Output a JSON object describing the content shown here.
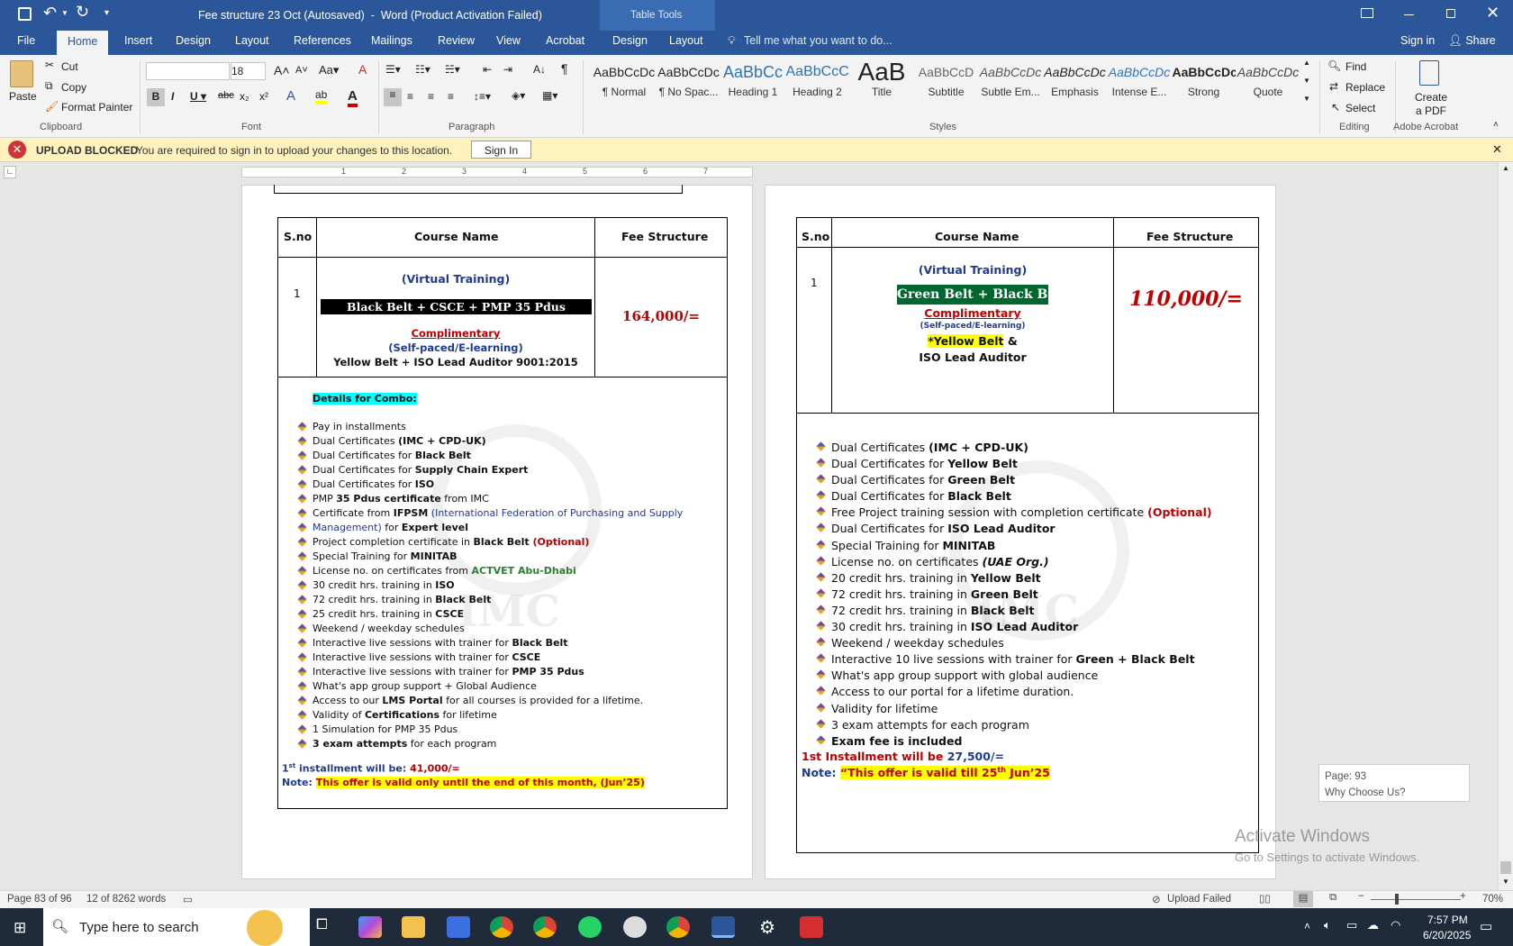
{
  "titlebar": {
    "title": "Fee structure 23 Oct (Autosaved)  -  Word (Product Activation Failed)",
    "table_tools": "Table Tools"
  },
  "tabs": {
    "file": "File",
    "home": "Home",
    "insert": "Insert",
    "design": "Design",
    "layout": "Layout",
    "references": "References",
    "mailings": "Mailings",
    "review": "Review",
    "view": "View",
    "acrobat": "Acrobat",
    "tt_design": "Design",
    "tt_layout": "Layout",
    "tell_me": "Tell me what you want to do...",
    "sign_in": "Sign in",
    "share": "Share"
  },
  "clipboard": {
    "paste": "Paste",
    "cut": "Cut",
    "copy": "Copy",
    "format_painter": "Format Painter",
    "label": "Clipboard"
  },
  "font": {
    "name": "",
    "size": "18",
    "label": "Font"
  },
  "paragraph": {
    "label": "Paragraph"
  },
  "styles": {
    "label": "Styles",
    "items": [
      {
        "preview": "AaBbCcDc",
        "name": "¶ Normal"
      },
      {
        "preview": "AaBbCcDc",
        "name": "¶ No Spac..."
      },
      {
        "preview": "AaBbCc",
        "name": "Heading 1"
      },
      {
        "preview": "AaBbCcC",
        "name": "Heading 2"
      },
      {
        "preview": "AaB",
        "name": "Title"
      },
      {
        "preview": "AaBbCcD",
        "name": "Subtitle"
      },
      {
        "preview": "AaBbCcDc",
        "name": "Subtle Em..."
      },
      {
        "preview": "AaBbCcDc",
        "name": "Emphasis"
      },
      {
        "preview": "AaBbCcDc",
        "name": "Intense E..."
      },
      {
        "preview": "AaBbCcDc",
        "name": "Strong"
      },
      {
        "preview": "AaBbCcDc",
        "name": "Quote"
      }
    ]
  },
  "editing": {
    "find": "Find",
    "replace": "Replace",
    "select": "Select",
    "label": "Editing"
  },
  "acrobat_group": {
    "create": "Create",
    "pdf": "a PDF",
    "label": "Adobe Acrobat"
  },
  "infobar": {
    "title": "UPLOAD BLOCKED",
    "message": "You are required to sign in to upload your changes to this location.",
    "button": "Sign In"
  },
  "left_page": {
    "headers": [
      "S.no",
      "Course Name",
      "Fee Structure"
    ],
    "sno": "1",
    "virtual": "(Virtual Training)",
    "course": "Black Belt + CSCE + PMP 35 Pdus",
    "complimentary": "Complimentary",
    "selfpaced": "(Self-paced/E-learning)",
    "extra": "Yellow Belt + ISO Lead Auditor 9001:2015",
    "fee": "164,000/=",
    "details": "Details for Combo:",
    "bullets": [
      [
        [
          "Pay in installments",
          ""
        ]
      ],
      [
        [
          "Dual Certificates ",
          ""
        ],
        [
          "(IMC + CPD-UK)",
          "b"
        ]
      ],
      [
        [
          "Dual Certificates for ",
          ""
        ],
        [
          "Black Belt",
          "b"
        ]
      ],
      [
        [
          "Dual Certificates for ",
          ""
        ],
        [
          "Supply Chain Expert",
          "b"
        ]
      ],
      [
        [
          "Dual Certificates for ",
          ""
        ],
        [
          "ISO",
          "b"
        ]
      ],
      [
        [
          "PMP ",
          ""
        ],
        [
          "35 Pdus certificate",
          "b"
        ],
        [
          " from IMC",
          ""
        ]
      ],
      [
        [
          "Certificate from ",
          ""
        ],
        [
          "IFPSM",
          "b"
        ],
        [
          " (International Federation of Purchasing and Supply",
          "nav"
        ]
      ],
      [
        [
          "Management)",
          "nav"
        ],
        [
          " for ",
          ""
        ],
        [
          "Expert level",
          "b"
        ]
      ],
      [
        [
          "Project completion certificate in ",
          ""
        ],
        [
          "Black Belt",
          "b"
        ],
        [
          " (Optional)",
          "red"
        ]
      ],
      [
        [
          "Special Training for ",
          ""
        ],
        [
          "MINITAB",
          "b"
        ]
      ],
      [
        [
          "License no. on certificates from ",
          ""
        ],
        [
          "ACTVET Abu-Dhabi",
          "grn"
        ]
      ],
      [
        [
          "30 credit hrs. training in ",
          ""
        ],
        [
          "ISO",
          "b"
        ]
      ],
      [
        [
          "72 credit hrs. training in ",
          ""
        ],
        [
          "Black Belt",
          "b"
        ]
      ],
      [
        [
          "25 credit hrs. training in ",
          ""
        ],
        [
          "CSCE",
          "b"
        ]
      ],
      [
        [
          "Weekend / weekday schedules",
          ""
        ]
      ],
      [
        [
          "Interactive live sessions with trainer for ",
          ""
        ],
        [
          "Black Belt",
          "b"
        ]
      ],
      [
        [
          "Interactive live sessions with trainer for ",
          ""
        ],
        [
          "CSCE",
          "b"
        ]
      ],
      [
        [
          "Interactive live sessions with trainer for ",
          ""
        ],
        [
          "PMP 35 Pdus",
          "b"
        ]
      ],
      [
        [
          "What's app group support + Global Audience",
          ""
        ]
      ],
      [
        [
          " Access to our ",
          ""
        ],
        [
          "LMS Portal",
          "b"
        ],
        [
          " for all courses is provided for a lifetime.",
          ""
        ]
      ],
      [
        [
          "Validity of ",
          ""
        ],
        [
          "Certifications",
          "b"
        ],
        [
          " for lifetime",
          ""
        ]
      ],
      [
        [
          "1 Simulation for PMP 35 Pdus",
          ""
        ]
      ],
      [
        [
          "3 exam attempts",
          "b"
        ],
        [
          " for each program",
          ""
        ]
      ]
    ],
    "installment_prefix": "1",
    "installment_sup": "st",
    "installment_label": " installment will be: ",
    "installment_amount": "41,000/=",
    "note_label": "Note: ",
    "note_text": "This offer is valid only until the end of this month, (Jun’25)"
  },
  "right_page": {
    "headers": [
      "S.no",
      "Course Name",
      "Fee Structure"
    ],
    "sno": "1",
    "virtual": "(Virtual Training)",
    "course": "Green Belt + Black Belt",
    "complimentary": "Complimentary",
    "selfpaced": "(Self-paced/E-learning)",
    "extra1": "*Yellow Belt",
    "extra1b": " &",
    "extra2": "ISO Lead Auditor",
    "fee": "110,000/=",
    "bullets": [
      [
        [
          "Dual Certificates ",
          ""
        ],
        [
          "(IMC + CPD-UK)",
          "b"
        ]
      ],
      [
        [
          "Dual Certificates for ",
          ""
        ],
        [
          "Yellow Belt",
          "b"
        ]
      ],
      [
        [
          "Dual Certificates for ",
          ""
        ],
        [
          "Green Belt",
          "b"
        ]
      ],
      [
        [
          "Dual Certificates for ",
          ""
        ],
        [
          "Black Belt",
          "b"
        ]
      ],
      [
        [
          "Free Project training session with completion certificate ",
          ""
        ],
        [
          "(Optional)",
          "redb"
        ]
      ],
      [
        [
          " Dual Certificates for ",
          ""
        ],
        [
          "ISO Lead Auditor",
          "b"
        ]
      ],
      [
        [
          "Special Training for ",
          ""
        ],
        [
          "MINITAB",
          "b"
        ]
      ],
      [
        [
          "License no. on certificates ",
          ""
        ],
        [
          "(UAE Org.)",
          "bi"
        ]
      ],
      [
        [
          "20 credit hrs. training in ",
          ""
        ],
        [
          "Yellow Belt",
          "b"
        ]
      ],
      [
        [
          "72 credit hrs. training in ",
          ""
        ],
        [
          "Green Belt",
          "b"
        ]
      ],
      [
        [
          "72 credit hrs. training in ",
          ""
        ],
        [
          "Black Belt",
          "b"
        ]
      ],
      [
        [
          "30 credit hrs. training in  ",
          ""
        ],
        [
          "ISO Lead Auditor",
          "b"
        ]
      ],
      [
        [
          " Weekend / weekday schedules",
          ""
        ]
      ],
      [
        [
          "Interactive 10 live sessions with trainer for ",
          ""
        ],
        [
          "Green + Black Belt",
          "b"
        ]
      ],
      [
        [
          "What's app group support with global audience",
          ""
        ]
      ],
      [
        [
          "Access to our portal for a lifetime duration.",
          ""
        ]
      ],
      [
        [
          "Validity for lifetime",
          ""
        ]
      ],
      [
        [
          "3 exam attempts for each program",
          ""
        ]
      ],
      [
        [
          "Exam fee is included",
          "b"
        ]
      ]
    ],
    "installment": "1st Installment will be ",
    "installment_amount": "27,500/=",
    "note_label": "Note: ",
    "note_text": "“This offer is valid till 25",
    "note_sup": "th",
    "note_end": " Jun’25"
  },
  "nav_tooltip": {
    "page": "Page: 93",
    "heading": "Why Choose Us?"
  },
  "watermark": {
    "line1": "Activate Windows",
    "line2": "Go to Settings to activate Windows."
  },
  "status": {
    "page": "Page 83 of 96",
    "words": "12 of 8262 words",
    "upload": "Upload Failed",
    "zoom": "70%"
  },
  "taskbar": {
    "search": "Type here to search",
    "time": "7:57 PM",
    "date": "6/20/2025"
  },
  "ruler_numbers": [
    "1",
    "2",
    "3",
    "4",
    "5",
    "6",
    "7"
  ]
}
